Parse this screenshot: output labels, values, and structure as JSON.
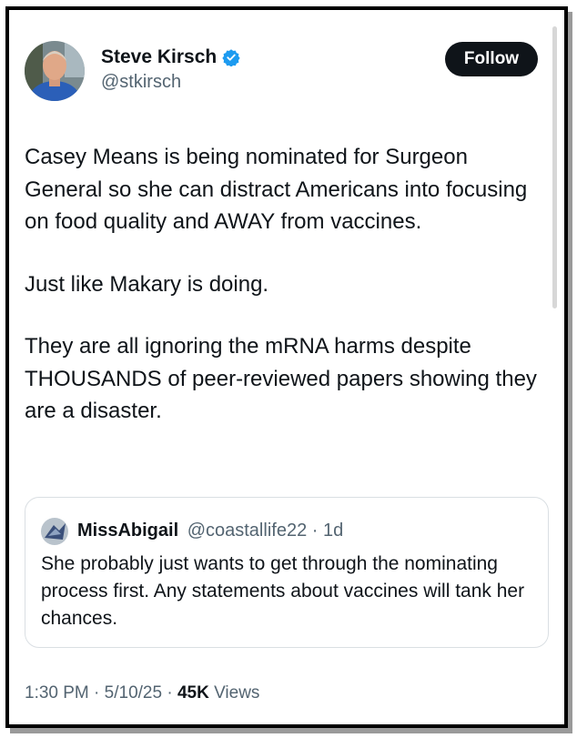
{
  "author": {
    "name": "Steve Kirsch",
    "handle": "@stkirsch",
    "avatar_icon": "profile-photo",
    "verified_icon": "verified-badge-icon",
    "verified_color": "#1d9bf0"
  },
  "follow_label": "Follow",
  "tweet": {
    "paragraphs": [
      "Casey Means is being nominated for Surgeon General so she can distract Americans into focusing on food quality and AWAY from vaccines.",
      "Just like Makary is doing.",
      "They are all ignoring the mRNA harms despite THOUSANDS of peer-reviewed papers showing they are a disaster."
    ]
  },
  "quote": {
    "name": "MissAbigail",
    "handle": "@coastallife22",
    "separator": "·",
    "time": "1d",
    "text": "She probably just wants to get through the nominating process first. Any statements about vaccines will tank her chances."
  },
  "meta": {
    "time": "1:30 PM",
    "separator": "·",
    "date": "5/10/25",
    "views_count": "45K",
    "views_label": "Views"
  },
  "colors": {
    "text": "#0f1419",
    "secondary": "#536471",
    "border": "#dadfe3",
    "button_bg": "#0f1419"
  }
}
